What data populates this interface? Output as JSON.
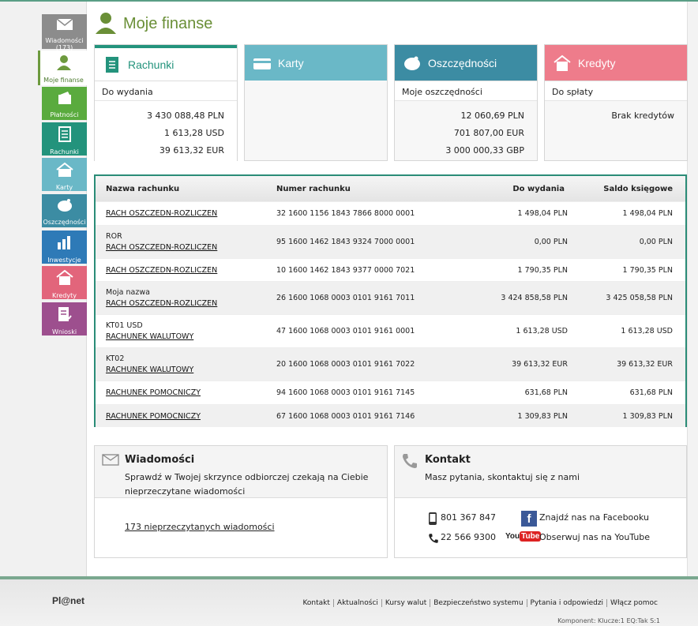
{
  "colors": {
    "accent_green": "#6a8f37",
    "teal": "#2a8c77",
    "cards_blue": "#6ab8c7",
    "savings_blue": "#3c8ca3",
    "credits_pink": "#ee7c8b"
  },
  "sidebar": [
    {
      "label": "Wiadomości",
      "sub": "(173)",
      "icon": "envelope-icon",
      "color": "#8c8c8c"
    },
    {
      "label": "Moje finanse",
      "icon": "person-icon",
      "color": "#ffffff"
    },
    {
      "label": "Płatności",
      "icon": "wallet-icon",
      "color": "#5aab3e"
    },
    {
      "label": "Rachunki",
      "icon": "document-icon",
      "color": "#23937c"
    },
    {
      "label": "Karty",
      "icon": "card-icon",
      "color": "#6ab8c7"
    },
    {
      "label": "Oszczędności",
      "icon": "piggy-bank-icon",
      "color": "#3c8ca3"
    },
    {
      "label": "Inwestycje",
      "icon": "chart-icon",
      "color": "#2e7ab7"
    },
    {
      "label": "Kredyty",
      "icon": "house-icon",
      "color": "#e2657b"
    },
    {
      "label": "Wnioski",
      "icon": "form-icon",
      "color": "#9d4f8e"
    }
  ],
  "page_title": "Moje finanse",
  "tiles": {
    "rachunki": {
      "title": "Rachunki",
      "sub": "Do wydania",
      "values": [
        "3 430 088,48 PLN",
        "1 613,28 USD",
        "39 613,32 EUR"
      ]
    },
    "karty": {
      "title": "Karty"
    },
    "oszczednosci": {
      "title": "Oszczędności",
      "sub": "Moje oszczędności",
      "values": [
        "12 060,69 PLN",
        "701 807,00 EUR",
        "3 000 000,33 GBP"
      ]
    },
    "kredyty": {
      "title": "Kredyty",
      "sub": "Do spłaty",
      "values": [
        "Brak kredytów"
      ]
    }
  },
  "table": {
    "headers": {
      "name": "Nazwa rachunku",
      "number": "Numer rachunku",
      "available": "Do wydania",
      "balance": "Saldo księgowe"
    },
    "rows": [
      {
        "nick": "",
        "name": "RACH OSZCZEDN-ROZLICZEN",
        "number": "32 1600 1156 1843 7866 8000 0001",
        "available": "1 498,04 PLN",
        "balance": "1 498,04 PLN"
      },
      {
        "nick": "ROR",
        "name": "RACH OSZCZEDN-ROZLICZEN",
        "number": "95 1600 1462 1843 9324 7000 0001",
        "available": "0,00 PLN",
        "balance": "0,00 PLN"
      },
      {
        "nick": "",
        "name": "RACH OSZCZEDN-ROZLICZEN",
        "number": "10 1600 1462 1843 9377 0000 7021",
        "available": "1 790,35 PLN",
        "balance": "1 790,35 PLN"
      },
      {
        "nick": "Moja nazwa",
        "name": "RACH OSZCZEDN-ROZLICZEN",
        "number": "26 1600 1068 0003 0101 9161 7011",
        "available": "3 424 858,58 PLN",
        "balance": "3 425 058,58 PLN"
      },
      {
        "nick": "KT01 USD",
        "name": "RACHUNEK WALUTOWY",
        "number": "47 1600 1068 0003 0101 9161 0001",
        "available": "1 613,28 USD",
        "balance": "1 613,28 USD"
      },
      {
        "nick": "KT02",
        "name": "RACHUNEK WALUTOWY",
        "number": "20 1600 1068 0003 0101 9161 7022",
        "available": "39 613,32 EUR",
        "balance": "39 613,32 EUR"
      },
      {
        "nick": "",
        "name": "RACHUNEK POMOCNICZY",
        "number": "94 1600 1068 0003 0101 9161 7145",
        "available": "631,68 PLN",
        "balance": "631,68 PLN"
      },
      {
        "nick": "",
        "name": "RACHUNEK POMOCNICZY",
        "number": "67 1600 1068 0003 0101 9161 7146",
        "available": "1 309,83 PLN",
        "balance": "1 309,83 PLN"
      }
    ]
  },
  "messages": {
    "title": "Wiadomości",
    "text1": "Sprawdź w Twojej skrzynce odbiorczej czekają na Ciebie",
    "text2": "nieprzeczytane wiadomości",
    "link": "173 nieprzeczytanych wiadomości"
  },
  "contact": {
    "title": "Kontakt",
    "text": "Masz pytania, skontaktuj się z nami",
    "mobile": "801 367 847",
    "phone": "22 566 9300",
    "facebook": "Znajdź nas na Facebooku",
    "youtube_logo": "YouTube",
    "youtube": "Obserwuj nas na YouTube"
  },
  "footer": {
    "brand": "Pl@net",
    "links": [
      "Kontakt",
      "Aktualności",
      "Kursy walut",
      "Bezpieczeństwo systemu",
      "Pytania i odpowiedzi",
      "Włącz pomoc"
    ],
    "meta": "Komponent: Klucze:1 EQ:Tak S:1"
  }
}
